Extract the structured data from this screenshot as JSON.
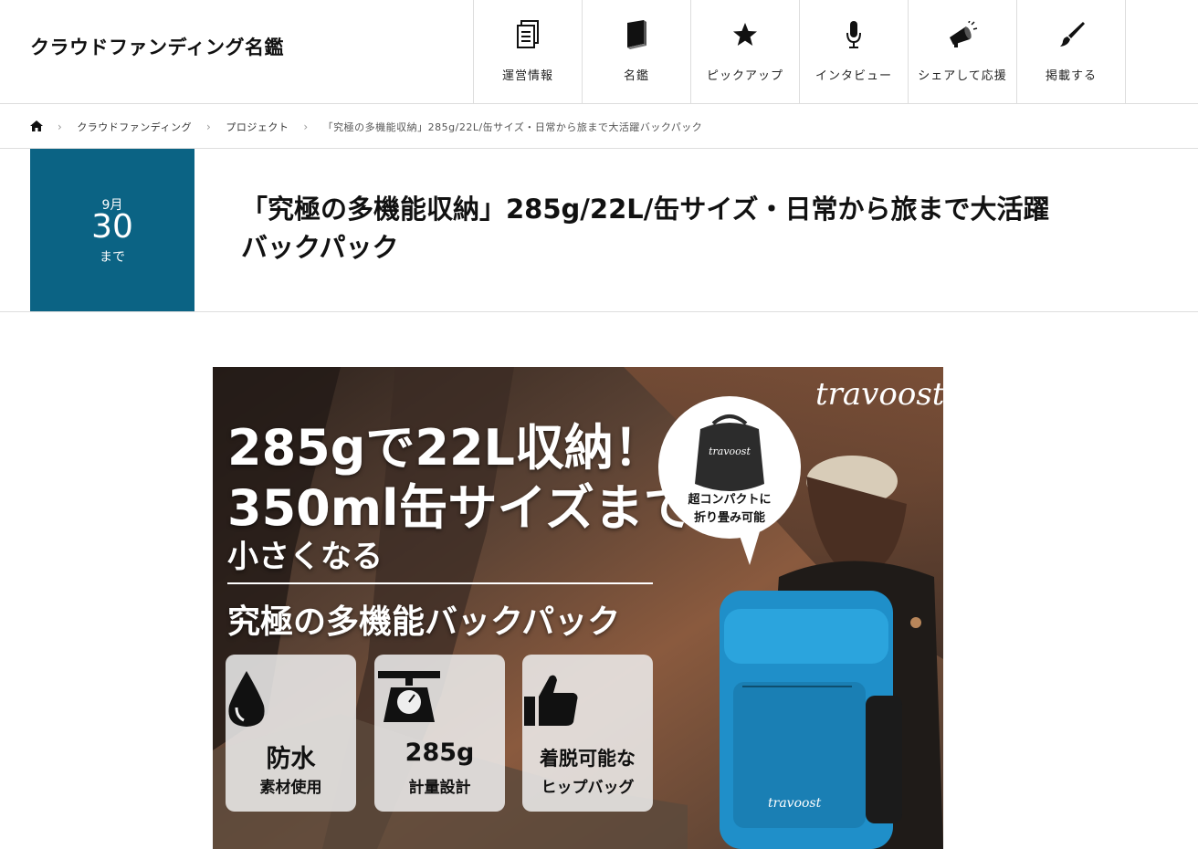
{
  "site": {
    "title": "クラウドファンディング名鑑"
  },
  "nav": [
    {
      "label": "運営情報",
      "icon": "document-icon"
    },
    {
      "label": "名鑑",
      "icon": "book-icon"
    },
    {
      "label": "ピックアップ",
      "icon": "star-icon"
    },
    {
      "label": "インタビュー",
      "icon": "microphone-icon"
    },
    {
      "label": "シェアして応援",
      "icon": "megaphone-icon"
    },
    {
      "label": "掲載する",
      "icon": "brush-icon"
    }
  ],
  "breadcrumb": {
    "home_icon": "home-icon",
    "items": [
      "クラウドファンディング",
      "プロジェクト",
      "「究極の多機能収納」285g/22L/缶サイズ・日常から旅まで大活躍バックパック"
    ]
  },
  "deadline": {
    "month": "9月",
    "day": "30",
    "suffix": "まで",
    "color": "#0b6384"
  },
  "page": {
    "title_line1": "「究極の多機能収納」285g/22L/缶サイズ・日常から旅まで大活躍",
    "title_line2": "バックパック"
  },
  "banner": {
    "brand": "travoost",
    "headline1": "285gで22L収納！",
    "headline2": "350ml缶サイズまで",
    "headline3": "小さくなる",
    "subhead": "究極の多機能バックパック",
    "bubble_line1": "超コンパクトに",
    "bubble_line2": "折り畳み可能",
    "pouch_brand": "travoost",
    "bag_brand": "travoost",
    "features": [
      {
        "big": "防水",
        "small": "素材使用",
        "icon": "water-drop-icon"
      },
      {
        "big": "285g",
        "small": "計量設計",
        "icon": "scale-icon"
      },
      {
        "big": "着脱可能な",
        "small": "ヒップバッグ",
        "icon": "thumbs-up-icon"
      }
    ]
  }
}
